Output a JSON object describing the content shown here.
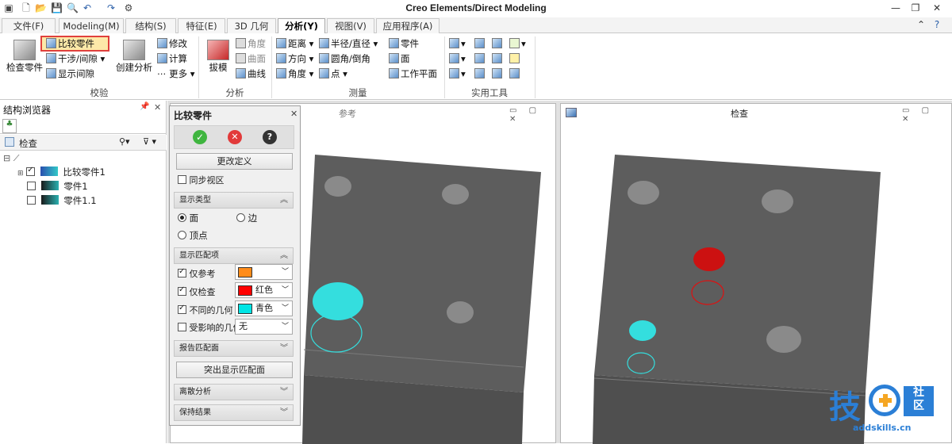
{
  "app": {
    "title": "Creo Elements/Direct Modeling"
  },
  "tabs": [
    {
      "label": "文件(F)"
    },
    {
      "label": "Modeling(M)"
    },
    {
      "label": "结构(S)"
    },
    {
      "label": "特征(E)"
    },
    {
      "label": "3D 几何"
    },
    {
      "label": "分析(Y)"
    },
    {
      "label": "视图(V)"
    },
    {
      "label": "应用程序(A)"
    }
  ],
  "ribbon": {
    "check": {
      "check_part": "检查零件",
      "compare_part": "比较零件",
      "interference": "干涉/间隙",
      "show_clearance": "显示间隙",
      "label": "校验"
    },
    "create": {
      "create_analysis": "创建分析",
      "modify": "修改",
      "calculate": "计算",
      "more": "更多"
    },
    "analysis": {
      "draft": "拔模",
      "angle": "角度",
      "surface": "曲面",
      "curve": "曲线",
      "label": "分析"
    },
    "measure": {
      "distance": "距离",
      "direction": "方向",
      "angle": "角度",
      "radius_diameter": "半径/直径",
      "fillet_chamfer": "圆角/倒角",
      "point": "点",
      "part": "零件",
      "face": "面",
      "workplane": "工作平面",
      "label": "测量"
    },
    "tools": {
      "label": "实用工具"
    }
  },
  "browser": {
    "title": "结构浏览器",
    "filter_label": "检查",
    "tree": [
      {
        "label": "比较零件1",
        "checked": true
      },
      {
        "label": "零件1",
        "checked": false
      },
      {
        "label": "零件1.1",
        "checked": false
      }
    ]
  },
  "compare_panel": {
    "title": "比较零件",
    "redefine_button": "更改定义",
    "sync_view": "同步视区",
    "display_type": {
      "header": "显示类型",
      "options": [
        "面",
        "边",
        "顶点"
      ],
      "selected": "面"
    },
    "display_match": {
      "header": "显示匹配项",
      "rows": [
        {
          "label": "仅参考",
          "checked": true,
          "color_name": "",
          "color": "#ff8c1a"
        },
        {
          "label": "仅检查",
          "checked": true,
          "color_name": "红色",
          "color": "#ff0000"
        },
        {
          "label": "不同的几何",
          "checked": true,
          "color_name": "青色",
          "color": "#00e5e5"
        },
        {
          "label": "受影响的几何",
          "checked": false,
          "color_name": "无",
          "color": ""
        }
      ]
    },
    "report_header": "报告匹配面",
    "highlight_button": "突出显示匹配面",
    "discrete_header": "离散分析",
    "keep_header": "保持结果"
  },
  "viewports": {
    "reference": {
      "title": "参考"
    },
    "check": {
      "title": "检查"
    }
  },
  "watermark": {
    "brand": "技术社区",
    "url": "addskills.cn"
  }
}
